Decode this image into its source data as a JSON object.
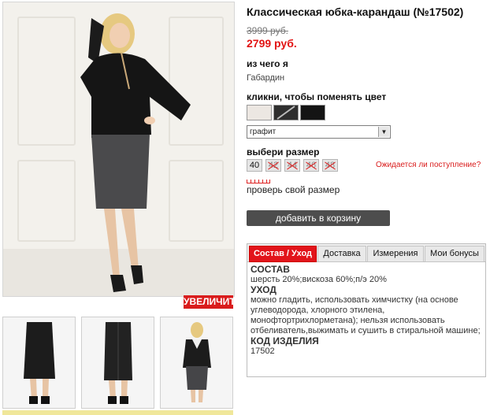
{
  "product": {
    "title": "Классическая юбка-карандаш (№17502)",
    "old_price": "3999 руб.",
    "new_price": "2799 руб."
  },
  "material": {
    "label": "из чего я",
    "value": "Габардин"
  },
  "color": {
    "label": "кликни, чтобы поменять цвет",
    "swatches": [
      "#e9e4df",
      "#3a3a3a",
      "#1a1a1a"
    ],
    "selected": "графит"
  },
  "size": {
    "label": "выбери размер",
    "options": [
      "40",
      "42",
      "44",
      "46",
      "48"
    ],
    "waiting_link": "Ожидается ли поступление?",
    "check_link": "проверь свой размер"
  },
  "cart_button": "добавить в корзину",
  "zoom_button": "УВЕЛИЧИТЬ",
  "tabs": [
    "Состав / Уход",
    "Доставка",
    "Измерения",
    "Мои бонусы"
  ],
  "tab_content": {
    "composition_heading": "СОСТАВ",
    "composition_value": "шерсть 20%;вискоза 60%;п/э 20%",
    "care_heading": "УХОД",
    "care_value": "можно гладить, использовать химчистку (на основе углеводорода, хлорного этилена, монофтортрихлорметана); нельзя использовать отбеливатель,выжимать и сушить в стиральной машине;",
    "code_heading": "КОД ИЗДЕЛИЯ",
    "code_value": "17502"
  },
  "colors": {
    "accent_red": "#e2141b",
    "button_dark": "#4d4d4d"
  }
}
